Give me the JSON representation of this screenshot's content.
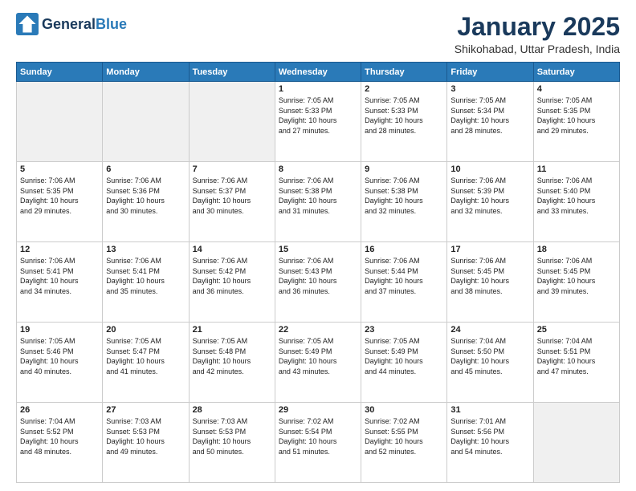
{
  "logo": {
    "general": "General",
    "blue": "Blue"
  },
  "header": {
    "title": "January 2025",
    "subtitle": "Shikohabad, Uttar Pradesh, India"
  },
  "days_of_week": [
    "Sunday",
    "Monday",
    "Tuesday",
    "Wednesday",
    "Thursday",
    "Friday",
    "Saturday"
  ],
  "weeks": [
    [
      {
        "day": "",
        "info": ""
      },
      {
        "day": "",
        "info": ""
      },
      {
        "day": "",
        "info": ""
      },
      {
        "day": "1",
        "info": "Sunrise: 7:05 AM\nSunset: 5:33 PM\nDaylight: 10 hours\nand 27 minutes."
      },
      {
        "day": "2",
        "info": "Sunrise: 7:05 AM\nSunset: 5:33 PM\nDaylight: 10 hours\nand 28 minutes."
      },
      {
        "day": "3",
        "info": "Sunrise: 7:05 AM\nSunset: 5:34 PM\nDaylight: 10 hours\nand 28 minutes."
      },
      {
        "day": "4",
        "info": "Sunrise: 7:05 AM\nSunset: 5:35 PM\nDaylight: 10 hours\nand 29 minutes."
      }
    ],
    [
      {
        "day": "5",
        "info": "Sunrise: 7:06 AM\nSunset: 5:35 PM\nDaylight: 10 hours\nand 29 minutes."
      },
      {
        "day": "6",
        "info": "Sunrise: 7:06 AM\nSunset: 5:36 PM\nDaylight: 10 hours\nand 30 minutes."
      },
      {
        "day": "7",
        "info": "Sunrise: 7:06 AM\nSunset: 5:37 PM\nDaylight: 10 hours\nand 30 minutes."
      },
      {
        "day": "8",
        "info": "Sunrise: 7:06 AM\nSunset: 5:38 PM\nDaylight: 10 hours\nand 31 minutes."
      },
      {
        "day": "9",
        "info": "Sunrise: 7:06 AM\nSunset: 5:38 PM\nDaylight: 10 hours\nand 32 minutes."
      },
      {
        "day": "10",
        "info": "Sunrise: 7:06 AM\nSunset: 5:39 PM\nDaylight: 10 hours\nand 32 minutes."
      },
      {
        "day": "11",
        "info": "Sunrise: 7:06 AM\nSunset: 5:40 PM\nDaylight: 10 hours\nand 33 minutes."
      }
    ],
    [
      {
        "day": "12",
        "info": "Sunrise: 7:06 AM\nSunset: 5:41 PM\nDaylight: 10 hours\nand 34 minutes."
      },
      {
        "day": "13",
        "info": "Sunrise: 7:06 AM\nSunset: 5:41 PM\nDaylight: 10 hours\nand 35 minutes."
      },
      {
        "day": "14",
        "info": "Sunrise: 7:06 AM\nSunset: 5:42 PM\nDaylight: 10 hours\nand 36 minutes."
      },
      {
        "day": "15",
        "info": "Sunrise: 7:06 AM\nSunset: 5:43 PM\nDaylight: 10 hours\nand 36 minutes."
      },
      {
        "day": "16",
        "info": "Sunrise: 7:06 AM\nSunset: 5:44 PM\nDaylight: 10 hours\nand 37 minutes."
      },
      {
        "day": "17",
        "info": "Sunrise: 7:06 AM\nSunset: 5:45 PM\nDaylight: 10 hours\nand 38 minutes."
      },
      {
        "day": "18",
        "info": "Sunrise: 7:06 AM\nSunset: 5:45 PM\nDaylight: 10 hours\nand 39 minutes."
      }
    ],
    [
      {
        "day": "19",
        "info": "Sunrise: 7:05 AM\nSunset: 5:46 PM\nDaylight: 10 hours\nand 40 minutes."
      },
      {
        "day": "20",
        "info": "Sunrise: 7:05 AM\nSunset: 5:47 PM\nDaylight: 10 hours\nand 41 minutes."
      },
      {
        "day": "21",
        "info": "Sunrise: 7:05 AM\nSunset: 5:48 PM\nDaylight: 10 hours\nand 42 minutes."
      },
      {
        "day": "22",
        "info": "Sunrise: 7:05 AM\nSunset: 5:49 PM\nDaylight: 10 hours\nand 43 minutes."
      },
      {
        "day": "23",
        "info": "Sunrise: 7:05 AM\nSunset: 5:49 PM\nDaylight: 10 hours\nand 44 minutes."
      },
      {
        "day": "24",
        "info": "Sunrise: 7:04 AM\nSunset: 5:50 PM\nDaylight: 10 hours\nand 45 minutes."
      },
      {
        "day": "25",
        "info": "Sunrise: 7:04 AM\nSunset: 5:51 PM\nDaylight: 10 hours\nand 47 minutes."
      }
    ],
    [
      {
        "day": "26",
        "info": "Sunrise: 7:04 AM\nSunset: 5:52 PM\nDaylight: 10 hours\nand 48 minutes."
      },
      {
        "day": "27",
        "info": "Sunrise: 7:03 AM\nSunset: 5:53 PM\nDaylight: 10 hours\nand 49 minutes."
      },
      {
        "day": "28",
        "info": "Sunrise: 7:03 AM\nSunset: 5:53 PM\nDaylight: 10 hours\nand 50 minutes."
      },
      {
        "day": "29",
        "info": "Sunrise: 7:02 AM\nSunset: 5:54 PM\nDaylight: 10 hours\nand 51 minutes."
      },
      {
        "day": "30",
        "info": "Sunrise: 7:02 AM\nSunset: 5:55 PM\nDaylight: 10 hours\nand 52 minutes."
      },
      {
        "day": "31",
        "info": "Sunrise: 7:01 AM\nSunset: 5:56 PM\nDaylight: 10 hours\nand 54 minutes."
      },
      {
        "day": "",
        "info": ""
      }
    ]
  ]
}
